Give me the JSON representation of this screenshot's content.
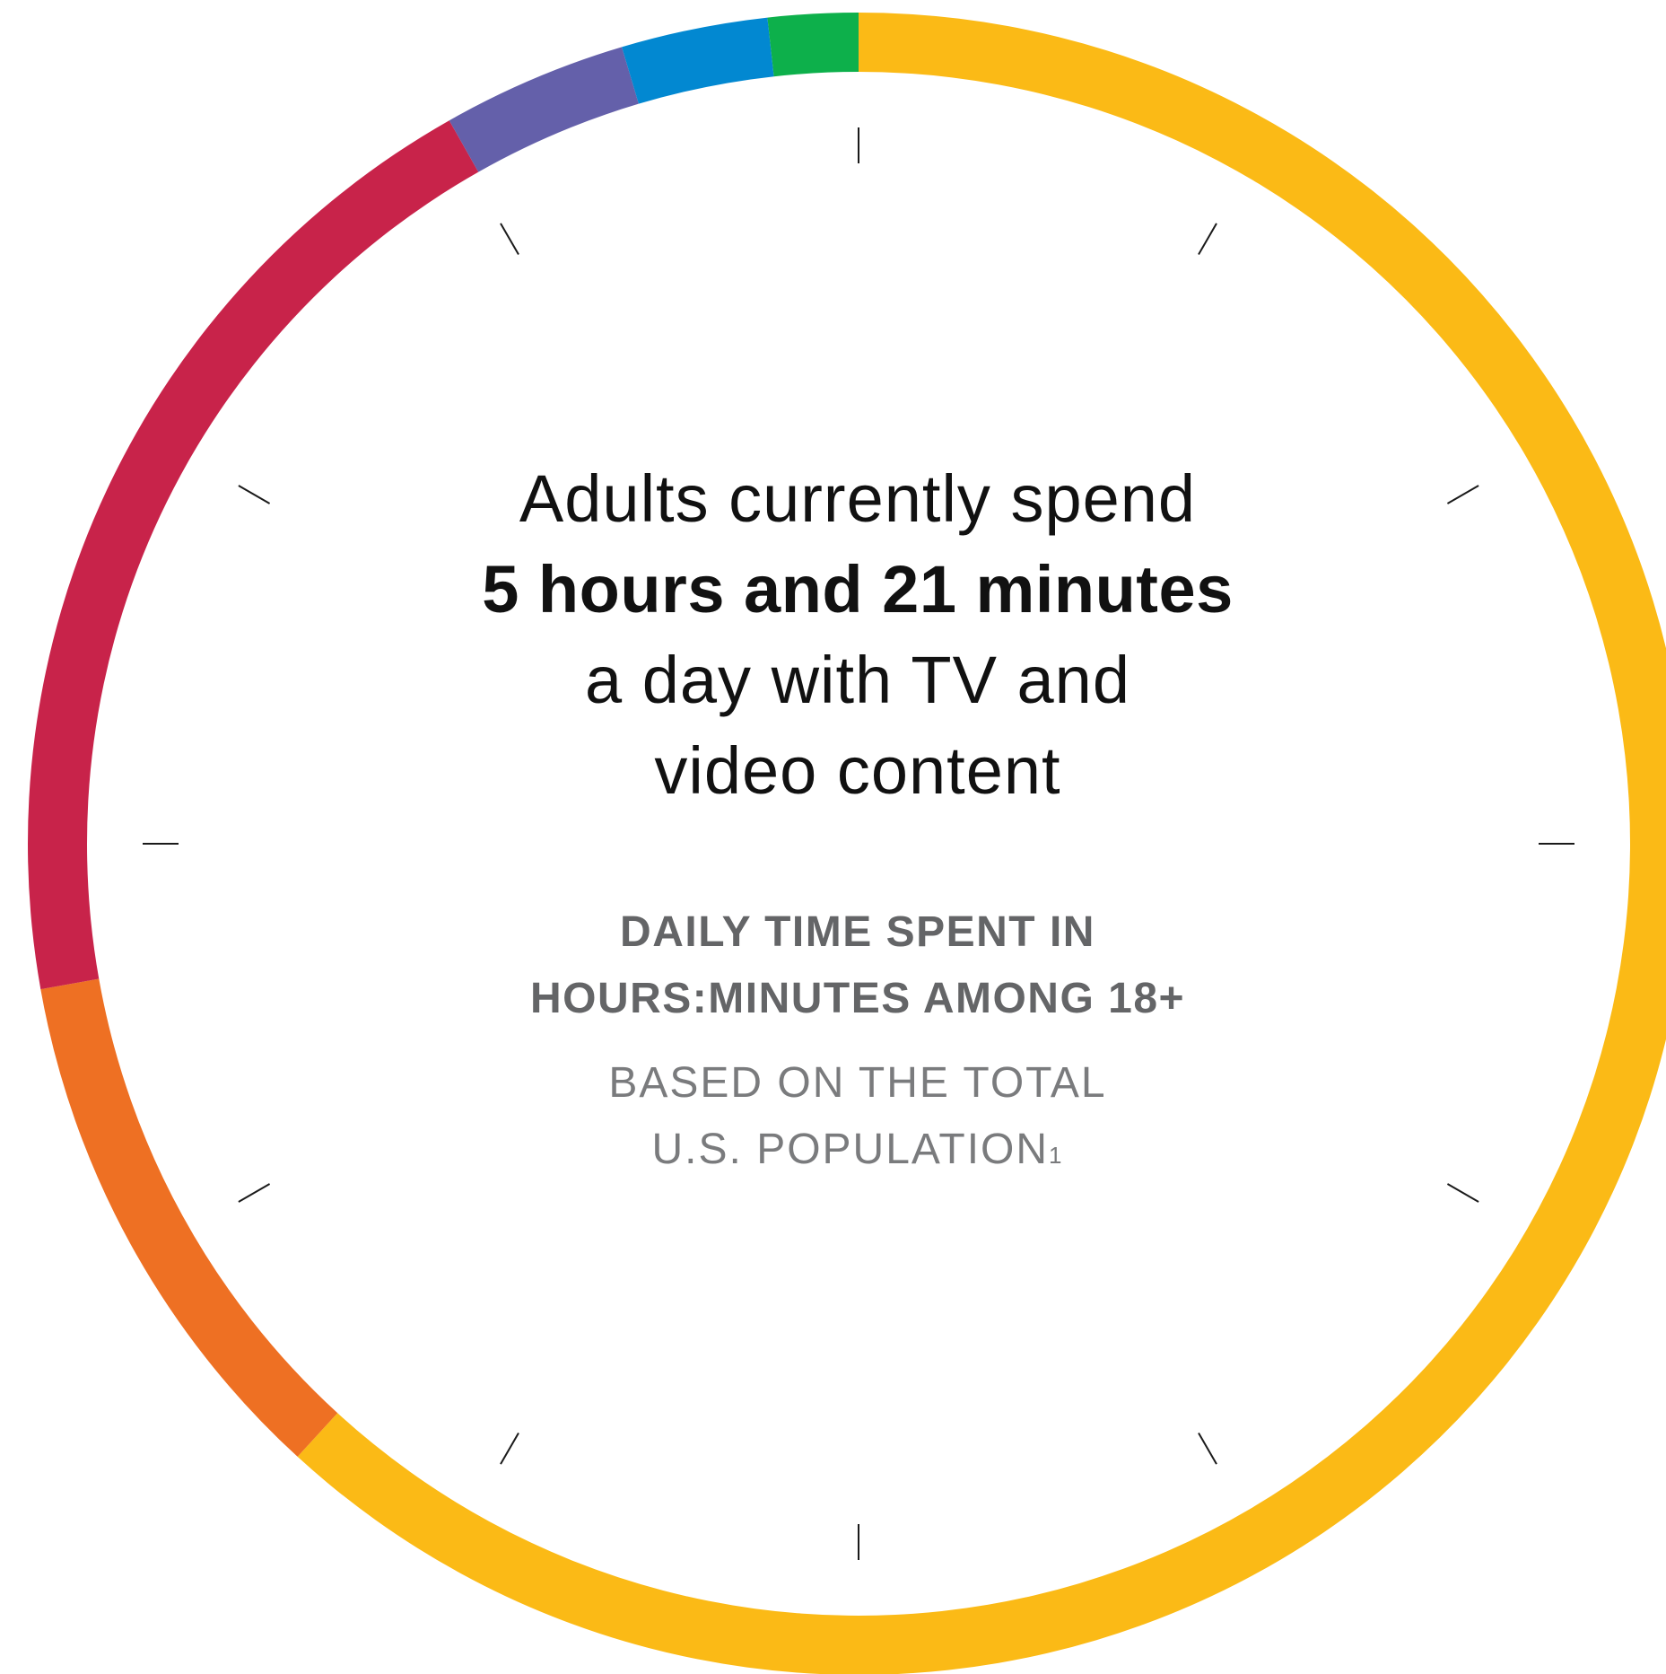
{
  "headline": {
    "line1": "Adults currently spend",
    "line2": "5 hours and 21 minutes",
    "line3": "a day with TV and",
    "line4": "video content"
  },
  "subhead": {
    "line1": "DAILY TIME SPENT IN",
    "line2": "HOURS:MINUTES AMONG 18+"
  },
  "note": {
    "line1": "BASED ON THE TOTAL",
    "line2": "U.S. POPULATION",
    "footnote_marker": "1"
  },
  "chart_data": {
    "type": "pie",
    "style": "donut ring with 12 clock-style tick marks",
    "start": "12 o'clock, clockwise",
    "segments": [
      {
        "color": "#FBBA16",
        "share": 0.618
      },
      {
        "color": "#EE7023",
        "share": 0.104
      },
      {
        "color": "#C8234A",
        "share": 0.196
      },
      {
        "color": "#6460AA",
        "share": 0.036
      },
      {
        "color": "#0288D1",
        "share": 0.0285
      },
      {
        "color": "#0DB04B",
        "share": 0.0175
      }
    ],
    "tick_count": 12
  }
}
